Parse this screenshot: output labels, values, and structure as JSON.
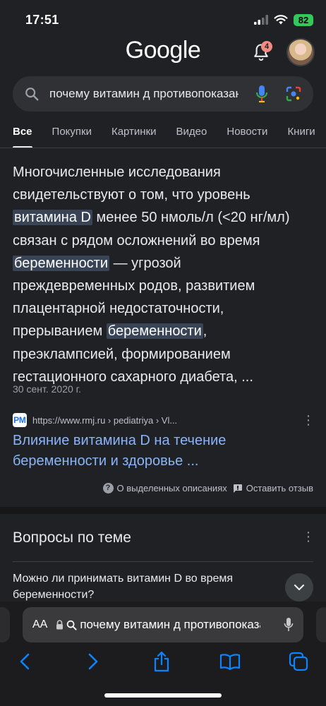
{
  "status_bar": {
    "time": "17:51",
    "battery": "82"
  },
  "header": {
    "logo": "Google",
    "notification_count": "4"
  },
  "search": {
    "query": "почему витамин д противопоказан"
  },
  "tabs": [
    {
      "label": "Все",
      "active": true
    },
    {
      "label": "Покупки"
    },
    {
      "label": "Картинки"
    },
    {
      "label": "Видео"
    },
    {
      "label": "Новости"
    },
    {
      "label": "Книги"
    }
  ],
  "featured_snippet": {
    "parts": [
      "Многочисленные исследования свидетельствуют о том, что уровень ",
      "витамина D",
      " менее 50 нмоль/л (<20 нг/мл) связан с рядом осложнений во время ",
      "беременности",
      " — угрозой преждевременных родов, развитием плацентарной недостаточности, прерыванием ",
      "беременности",
      ", преэклампсией, формированием гестационного сахарного диабета, ..."
    ],
    "date": "30 сент. 2020 г.",
    "favicon_text": "РМ",
    "source_url": "https://www.rmj.ru › pediatriya › Vl...",
    "title": "Влияние витамина D на течение беременности и здоровье ..."
  },
  "feedback": {
    "about_label": "О выделенных описаниях",
    "feedback_label": "Оставить отзыв"
  },
  "related": {
    "title": "Вопросы по теме",
    "first_question": "Можно ли принимать витамин D во время беременности?"
  },
  "browser": {
    "aa_label": "AA",
    "address_text": "почему витамин д противопоказан"
  }
}
